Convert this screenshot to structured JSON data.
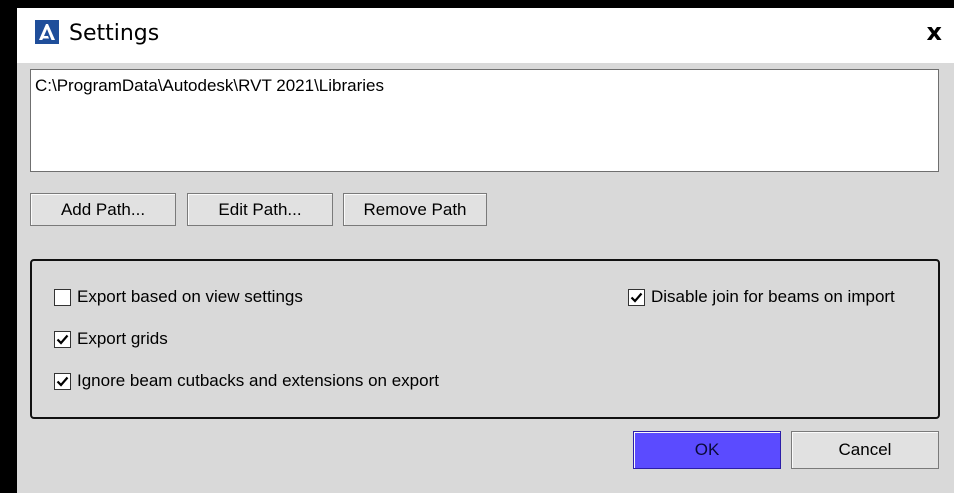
{
  "window": {
    "title": "Settings",
    "close_label": "x"
  },
  "library_paths": [
    "C:\\ProgramData\\Autodesk\\RVT 2021\\Libraries"
  ],
  "path_buttons": {
    "add": "Add Path...",
    "edit": "Edit Path...",
    "remove": "Remove Path"
  },
  "options": {
    "export_view_settings": {
      "label": "Export based on view settings",
      "checked": false
    },
    "export_grids": {
      "label": "Export grids",
      "checked": true
    },
    "ignore_cutbacks": {
      "label": "Ignore beam cutbacks and extensions on export",
      "checked": true
    },
    "disable_join": {
      "label": "Disable join for beams on import",
      "checked": true
    }
  },
  "dialog_buttons": {
    "ok": "OK",
    "cancel": "Cancel"
  },
  "colors": {
    "ok_button": "#5b4bff",
    "dialog_background": "#d9d9d9",
    "app_icon": "#1f4e9a"
  }
}
